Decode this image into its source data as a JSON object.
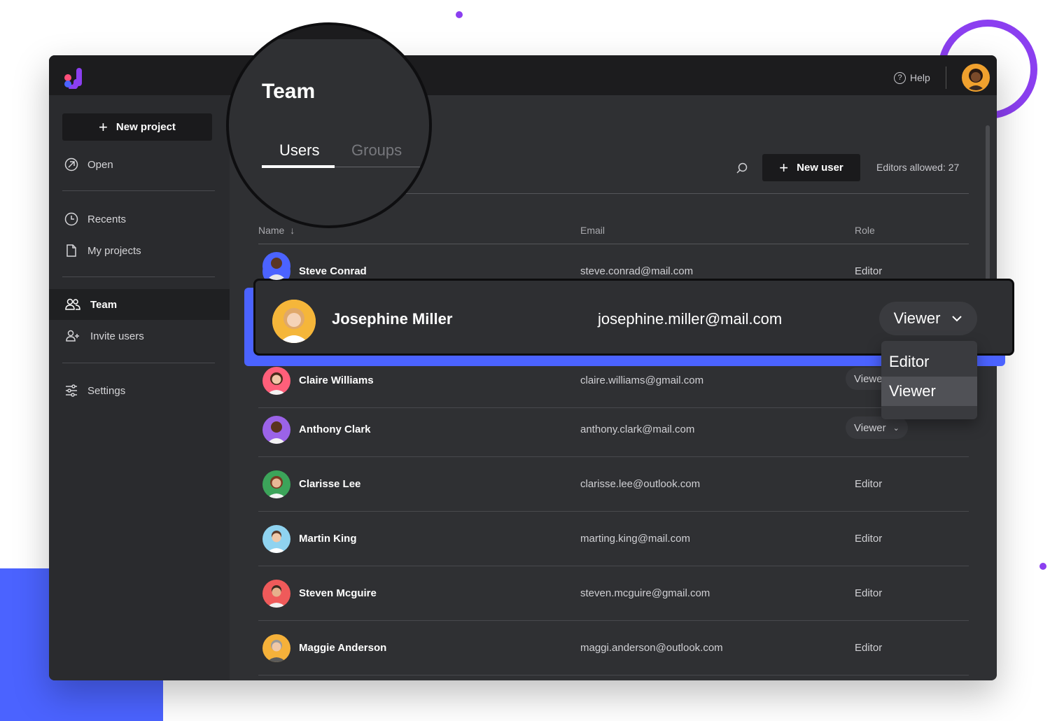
{
  "topbar": {
    "help_label": "Help"
  },
  "sidebar": {
    "new_project_label": "New project",
    "items": [
      {
        "label": "Open",
        "icon": "open-arrow-icon"
      },
      {
        "label": "Recents",
        "icon": "clock-icon"
      },
      {
        "label": "My projects",
        "icon": "file-icon"
      },
      {
        "label": "Team",
        "icon": "users-icon",
        "active": true
      },
      {
        "label": "Invite users",
        "icon": "user-plus-icon"
      },
      {
        "label": "Settings",
        "icon": "sliders-icon"
      }
    ]
  },
  "page": {
    "title": "Team",
    "tabs": [
      {
        "label": "Users",
        "active": true
      },
      {
        "label": "Groups",
        "active": false
      }
    ],
    "new_user_label": "New user",
    "editors_allowed": "Editors allowed: 27"
  },
  "table": {
    "headers": {
      "name": "Name",
      "email": "Email",
      "role": "Role"
    },
    "rows": [
      {
        "name": "Steve Conrad",
        "email": "steve.conrad@mail.com",
        "role": "Editor"
      },
      {
        "name": "Josephine Miller",
        "email": "josephine.miller@mail.com",
        "role": "Viewer"
      },
      {
        "name": "Claire Williams",
        "email": "claire.williams@gmail.com",
        "role": "Viewer"
      },
      {
        "name": "Anthony Clark",
        "email": "anthony.clark@mail.com",
        "role": "Viewer"
      },
      {
        "name": "Clarisse Lee",
        "email": "clarisse.lee@outlook.com",
        "role": "Editor"
      },
      {
        "name": "Martin King",
        "email": "marting.king@mail.com",
        "role": "Editor"
      },
      {
        "name": "Steven Mcguire",
        "email": "steven.mcguire@gmail.com",
        "role": "Editor"
      },
      {
        "name": "Maggie Anderson",
        "email": "maggi.anderson@outlook.com",
        "role": "Editor"
      }
    ]
  },
  "role_dropdown": {
    "options": [
      "Editor",
      "Viewer"
    ],
    "selected": "Viewer"
  },
  "colors": {
    "accent_blue": "#4b63ff",
    "accent_purple": "#8b3ff0",
    "window_bg": "#2f3033",
    "topbar_bg": "#1c1c1e"
  }
}
